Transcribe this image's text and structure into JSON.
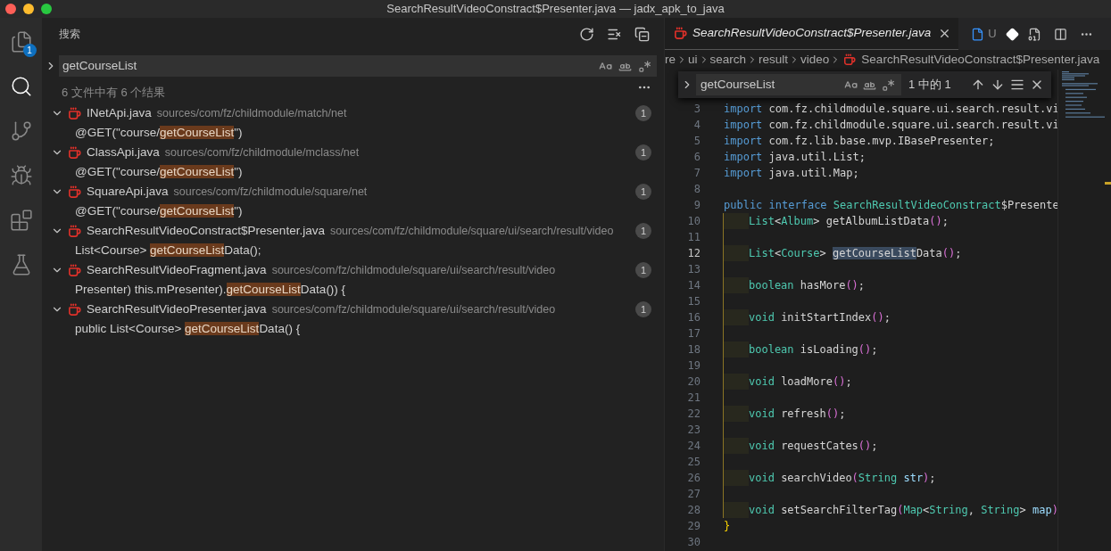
{
  "window": {
    "title": "SearchResultVideoConstract$Presenter.java — jadx_apk_to_java"
  },
  "activity_bar": {
    "items": [
      {
        "kind": "files",
        "selected": false,
        "badge": "1"
      },
      {
        "kind": "search",
        "selected": true
      },
      {
        "kind": "source-control",
        "selected": false
      },
      {
        "kind": "debug",
        "selected": false
      },
      {
        "kind": "extensions",
        "selected": false
      },
      {
        "kind": "testing",
        "selected": false
      }
    ]
  },
  "search_panel": {
    "title": "搜索",
    "query": "getCourseList",
    "options": [
      {
        "kind": "case",
        "on": false
      },
      {
        "kind": "word",
        "on": false
      },
      {
        "kind": "regex",
        "on": false
      }
    ],
    "summary": "6 文件中有 6 个结果",
    "results": [
      {
        "file": "INetApi.java",
        "path": "sources/com/fz/childmodule/match/net",
        "count": "1",
        "expanded": true,
        "match": {
          "before": "@GET(\"course/",
          "match": "getCourseList",
          "after": "\")"
        }
      },
      {
        "file": "ClassApi.java",
        "path": "sources/com/fz/childmodule/mclass/net",
        "count": "1",
        "expanded": true,
        "match": {
          "before": "@GET(\"course/",
          "match": "getCourseList",
          "after": "\")"
        }
      },
      {
        "file": "SquareApi.java",
        "path": "sources/com/fz/childmodule/square/net",
        "count": "1",
        "expanded": true,
        "match": {
          "before": "@GET(\"course/",
          "match": "getCourseList",
          "after": "\")"
        }
      },
      {
        "file": "SearchResultVideoConstract$Presenter.java",
        "path": "sources/com/fz/childmodule/square/ui/search/result/video",
        "count": "1",
        "expanded": true,
        "match": {
          "before": "List<Course> ",
          "match": "getCourseList",
          "after": "Data();"
        }
      },
      {
        "file": "SearchResultVideoFragment.java",
        "path": "sources/com/fz/childmodule/square/ui/search/result/video",
        "count": "1",
        "expanded": true,
        "match": {
          "before": "Presenter) this.mPresenter).",
          "match": "getCourseList",
          "after": "Data()) {"
        }
      },
      {
        "file": "SearchResultVideoPresenter.java",
        "path": "sources/com/fz/childmodule/square/ui/search/result/video",
        "count": "1",
        "expanded": true,
        "match": {
          "before": "public List<Course> ",
          "match": "getCourseList",
          "after": "Data() {"
        }
      }
    ]
  },
  "editor": {
    "tab": {
      "title": "SearchResultVideoConstract$Presenter.java",
      "preview": true
    },
    "git_status": "U",
    "breadcrumb": [
      {
        "kind": "folder",
        "text": "re"
      },
      {
        "kind": "folder",
        "text": "ui"
      },
      {
        "kind": "folder",
        "text": "search"
      },
      {
        "kind": "folder",
        "text": "result"
      },
      {
        "kind": "folder",
        "text": "video"
      },
      {
        "kind": "file",
        "text": "SearchResultVideoConstract$Presenter.java"
      }
    ],
    "find": {
      "query": "getCourseList",
      "result": "1 中的 1",
      "expanded": false
    },
    "lines": [
      {
        "number": "3",
        "current": false,
        "in_block": false,
        "tokens": [
          {
            "kind": "kw",
            "t": "import"
          },
          {
            "kind": "plain",
            "t": " com.fz.childmodule.square.ui.search.result.vi"
          }
        ]
      },
      {
        "number": "4",
        "current": false,
        "in_block": false,
        "tokens": [
          {
            "kind": "kw",
            "t": "import"
          },
          {
            "kind": "plain",
            "t": " com.fz.childmodule.square.ui.search.result.vi"
          }
        ]
      },
      {
        "number": "5",
        "current": false,
        "in_block": false,
        "tokens": [
          {
            "kind": "kw",
            "t": "import"
          },
          {
            "kind": "plain",
            "t": " com.fz.lib.base.mvp.IBasePresenter;"
          }
        ]
      },
      {
        "number": "6",
        "current": false,
        "in_block": false,
        "tokens": [
          {
            "kind": "kw",
            "t": "import"
          },
          {
            "kind": "plain",
            "t": " java.util.List;"
          }
        ]
      },
      {
        "number": "7",
        "current": false,
        "in_block": false,
        "tokens": [
          {
            "kind": "kw",
            "t": "import"
          },
          {
            "kind": "plain",
            "t": " java.util.Map;"
          }
        ]
      },
      {
        "number": "8",
        "current": false,
        "in_block": false
      },
      {
        "number": "9",
        "current": false,
        "in_block": false,
        "tokens": [
          {
            "kind": "kw",
            "t": "public interface "
          },
          {
            "kind": "type",
            "t": "SearchResultVideoConstract"
          },
          {
            "kind": "plain",
            "t": "$Presente"
          }
        ]
      },
      {
        "number": "10",
        "current": false,
        "in_block": true,
        "tokens": [
          {
            "kind": "type",
            "t": "List"
          },
          {
            "kind": "plain",
            "t": "<"
          },
          {
            "kind": "type",
            "t": "Album"
          },
          {
            "kind": "plain",
            "t": "> getAlbumListData"
          },
          {
            "kind": "paren",
            "t": "()"
          },
          {
            "kind": "plain",
            "t": ";"
          }
        ]
      },
      {
        "number": "11",
        "current": false,
        "in_block": true
      },
      {
        "number": "12",
        "current": true,
        "in_block": true,
        "tokens": [
          {
            "kind": "type",
            "t": "List"
          },
          {
            "kind": "plain",
            "t": "<"
          },
          {
            "kind": "type",
            "t": "Course"
          },
          {
            "kind": "plain",
            "t": "> "
          },
          {
            "kind": "match",
            "t": "getCourseList"
          },
          {
            "kind": "plain",
            "t": "Data"
          },
          {
            "kind": "paren",
            "t": "()"
          },
          {
            "kind": "plain",
            "t": ";"
          }
        ]
      },
      {
        "number": "13",
        "current": false,
        "in_block": true
      },
      {
        "number": "14",
        "current": false,
        "in_block": true,
        "tokens": [
          {
            "kind": "type",
            "t": "boolean"
          },
          {
            "kind": "plain",
            "t": " hasMore"
          },
          {
            "kind": "paren",
            "t": "()"
          },
          {
            "kind": "plain",
            "t": ";"
          }
        ]
      },
      {
        "number": "15",
        "current": false,
        "in_block": true
      },
      {
        "number": "16",
        "current": false,
        "in_block": true,
        "tokens": [
          {
            "kind": "type",
            "t": "void"
          },
          {
            "kind": "plain",
            "t": " initStartIndex"
          },
          {
            "kind": "paren",
            "t": "()"
          },
          {
            "kind": "plain",
            "t": ";"
          }
        ]
      },
      {
        "number": "17",
        "current": false,
        "in_block": true
      },
      {
        "number": "18",
        "current": false,
        "in_block": true,
        "tokens": [
          {
            "kind": "type",
            "t": "boolean"
          },
          {
            "kind": "plain",
            "t": " isLoading"
          },
          {
            "kind": "paren",
            "t": "()"
          },
          {
            "kind": "plain",
            "t": ";"
          }
        ]
      },
      {
        "number": "19",
        "current": false,
        "in_block": true
      },
      {
        "number": "20",
        "current": false,
        "in_block": true,
        "tokens": [
          {
            "kind": "type",
            "t": "void"
          },
          {
            "kind": "plain",
            "t": " loadMore"
          },
          {
            "kind": "paren",
            "t": "()"
          },
          {
            "kind": "plain",
            "t": ";"
          }
        ]
      },
      {
        "number": "21",
        "current": false,
        "in_block": true
      },
      {
        "number": "22",
        "current": false,
        "in_block": true,
        "tokens": [
          {
            "kind": "type",
            "t": "void"
          },
          {
            "kind": "plain",
            "t": " refresh"
          },
          {
            "kind": "paren",
            "t": "()"
          },
          {
            "kind": "plain",
            "t": ";"
          }
        ]
      },
      {
        "number": "23",
        "current": false,
        "in_block": true
      },
      {
        "number": "24",
        "current": false,
        "in_block": true,
        "tokens": [
          {
            "kind": "type",
            "t": "void"
          },
          {
            "kind": "plain",
            "t": " requestCates"
          },
          {
            "kind": "paren",
            "t": "()"
          },
          {
            "kind": "plain",
            "t": ";"
          }
        ]
      },
      {
        "number": "25",
        "current": false,
        "in_block": true
      },
      {
        "number": "26",
        "current": false,
        "in_block": true,
        "tokens": [
          {
            "kind": "type",
            "t": "void"
          },
          {
            "kind": "plain",
            "t": " searchVideo"
          },
          {
            "kind": "paren",
            "t": "("
          },
          {
            "kind": "type",
            "t": "String"
          },
          {
            "kind": "var",
            "t": " str"
          },
          {
            "kind": "paren",
            "t": ")"
          },
          {
            "kind": "plain",
            "t": ";"
          }
        ]
      },
      {
        "number": "27",
        "current": false,
        "in_block": true
      },
      {
        "number": "28",
        "current": false,
        "in_block": true,
        "tokens": [
          {
            "kind": "type",
            "t": "void"
          },
          {
            "kind": "plain",
            "t": " setSearchFilterTag"
          },
          {
            "kind": "paren",
            "t": "("
          },
          {
            "kind": "type",
            "t": "Map"
          },
          {
            "kind": "plain",
            "t": "<"
          },
          {
            "kind": "type",
            "t": "String"
          },
          {
            "kind": "plain",
            "t": ", "
          },
          {
            "kind": "type",
            "t": "String"
          },
          {
            "kind": "plain",
            "t": "> "
          },
          {
            "kind": "var",
            "t": "map"
          },
          {
            "kind": "paren",
            "t": ")"
          }
        ]
      },
      {
        "number": "29",
        "current": false,
        "in_block": false,
        "tokens": [
          {
            "kind": "brace",
            "t": "}"
          }
        ]
      },
      {
        "number": "30",
        "current": false,
        "in_block": false
      }
    ]
  }
}
